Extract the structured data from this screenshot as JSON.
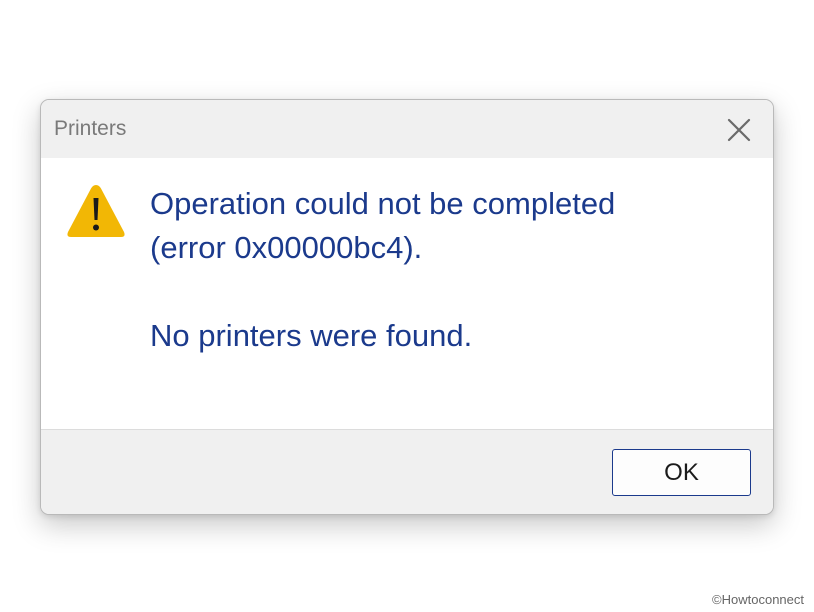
{
  "window": {
    "title": "Printers",
    "close_icon": "close-icon"
  },
  "message": {
    "line1": "Operation could not be completed",
    "line2": "(error 0x00000bc4).",
    "line3": "No printers were found.",
    "icon": "warning-icon"
  },
  "buttons": {
    "ok_label": "OK"
  },
  "watermark": "©Howtoconnect",
  "colors": {
    "message_text": "#1b3a8c",
    "warning_yellow": "#f2b705",
    "button_border": "#1b3a8c",
    "title_text": "#7a7a7a"
  }
}
